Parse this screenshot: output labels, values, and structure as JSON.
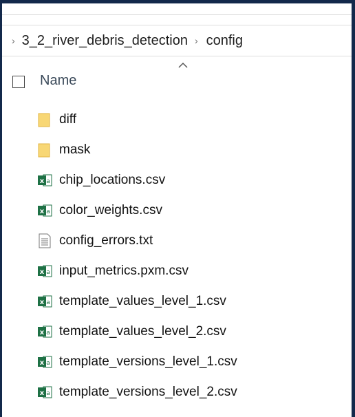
{
  "breadcrumb": {
    "items": [
      "3_2_river_debris_detection",
      "config"
    ]
  },
  "columns": {
    "name": "Name"
  },
  "files": [
    {
      "name": "diff",
      "icon": "folder-icon"
    },
    {
      "name": "mask",
      "icon": "folder-icon"
    },
    {
      "name": "chip_locations.csv",
      "icon": "excel-icon"
    },
    {
      "name": "color_weights.csv",
      "icon": "excel-icon"
    },
    {
      "name": "config_errors.txt",
      "icon": "text-file-icon"
    },
    {
      "name": "input_metrics.pxm.csv",
      "icon": "excel-icon"
    },
    {
      "name": "template_values_level_1.csv",
      "icon": "excel-icon"
    },
    {
      "name": "template_values_level_2.csv",
      "icon": "excel-icon"
    },
    {
      "name": "template_versions_level_1.csv",
      "icon": "excel-icon"
    },
    {
      "name": "template_versions_level_2.csv",
      "icon": "excel-icon"
    }
  ],
  "colors": {
    "window_border": "#13294b",
    "folder": "#f8d775",
    "excel": "#1e7145"
  }
}
